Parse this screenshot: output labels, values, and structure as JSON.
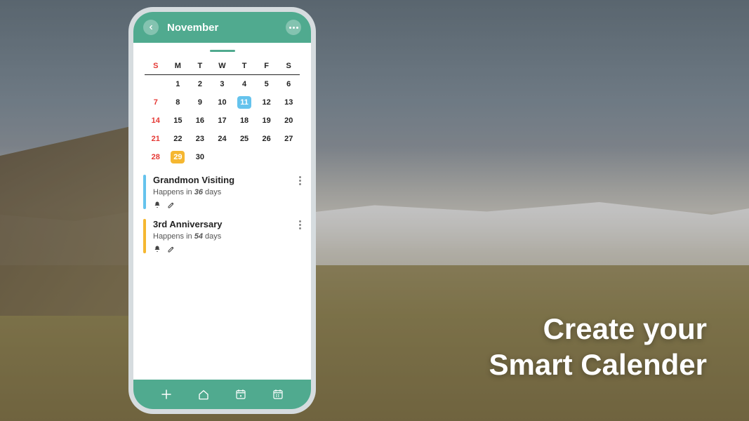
{
  "headline": {
    "line1": "Create your",
    "line2": "Smart Calender"
  },
  "header": {
    "month": "November"
  },
  "calendar": {
    "dayHeaders": [
      "S",
      "M",
      "T",
      "W",
      "T",
      "F",
      "S"
    ],
    "weeks": [
      [
        null,
        "1",
        "2",
        "3",
        "4",
        "5",
        "6"
      ],
      [
        "7",
        "8",
        "9",
        "10",
        "11",
        "12",
        "13"
      ],
      [
        "14",
        "15",
        "16",
        "17",
        "18",
        "19",
        "20"
      ],
      [
        "21",
        "22",
        "23",
        "24",
        "25",
        "26",
        "27"
      ],
      [
        "28",
        "29",
        "30",
        null,
        null,
        null,
        null
      ]
    ],
    "highlight_blue": "11",
    "highlight_yellow": "29"
  },
  "events": [
    {
      "title": "Grandmon Visiting",
      "prefix": "Happens in ",
      "count": "36",
      "suffix": " days",
      "color": "blue"
    },
    {
      "title": "3rd Anniversary",
      "prefix": "Happens in ",
      "count": "54",
      "suffix": " days",
      "color": "yellow"
    }
  ],
  "icons": {
    "back": "back",
    "more": "more",
    "bell": "bell",
    "edit": "edit",
    "add": "add",
    "home": "home",
    "cal1": "calendar-single",
    "cal2": "calendar-multi"
  }
}
